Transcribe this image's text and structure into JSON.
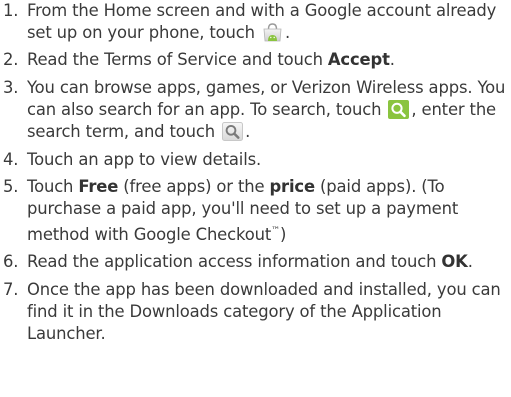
{
  "steps": [
    {
      "num": "1.",
      "a": "From the Home screen and with a Google account already set up on your phone, touch",
      "b": "."
    },
    {
      "num": "2.",
      "a": "Read the Terms of Service and touch ",
      "bold": "Accept",
      "b": "."
    },
    {
      "num": "3.",
      "a": "You can browse apps, games, or Verizon Wireless apps. You can also search for an app. To search, touch",
      "b": ", enter the search term, and touch",
      "c": "."
    },
    {
      "num": "4.",
      "a": "Touch an app to view details."
    },
    {
      "num": "5.",
      "a": "Touch ",
      "bold1": "Free",
      "b": " (free apps) or the ",
      "bold2": "price",
      "c": " (paid apps). (To purchase a paid app, you'll need to set up a payment method with Google Checkout",
      "tm": "™",
      "d": ")"
    },
    {
      "num": "6.",
      "a": "Read the application access information and touch ",
      "bold": "OK",
      "b": "."
    },
    {
      "num": "7.",
      "a": "Once the app has been downloaded and installed, you can find it in the Downloads category of the Application Launcher."
    }
  ],
  "icons": {
    "market": "android-market-bag-icon",
    "search_green": "search-magnifier-icon",
    "search_gray": "search-icon"
  },
  "colors": {
    "text": "#3a3a3a",
    "accent_green": "#8ac43f"
  }
}
